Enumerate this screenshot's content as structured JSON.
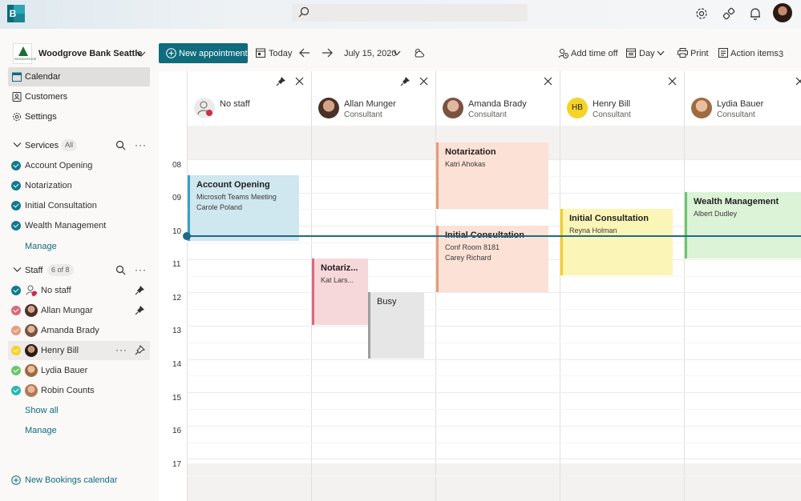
{
  "app": {
    "logo_letter": "B",
    "brand_color": "#0f6c7d"
  },
  "search": {
    "placeholder": ""
  },
  "org": {
    "name": "Woodgrove Bank Seattle",
    "logo_text": "WOODGROVE"
  },
  "nav": {
    "calendar": "Calendar",
    "customers": "Customers",
    "settings": "Settings"
  },
  "services": {
    "title": "Services",
    "filter": "All",
    "items": [
      "Account Opening",
      "Notarization",
      "Initial Consultation",
      "Wealth Management"
    ],
    "manage": "Manage"
  },
  "staff": {
    "title": "Staff",
    "count": "6 of 8",
    "items": [
      {
        "name": "No staff",
        "color": "#0f7a8c"
      },
      {
        "name": "Allan Mungar",
        "color": "#d86a7a"
      },
      {
        "name": "Amanda Brady",
        "color": "#e89a7a"
      },
      {
        "name": "Henry Bill",
        "color": "#f5d327"
      },
      {
        "name": "Lydia Bauer",
        "color": "#6cc66c"
      },
      {
        "name": "Robin Counts",
        "color": "#2ab7b3"
      }
    ],
    "show_all": "Show all",
    "manage": "Manage"
  },
  "new_calendar": "New Bookings calendar",
  "toolbar": {
    "new_appointment": "New appointment",
    "today": "Today",
    "date": "July 15, 2020",
    "add_time_off": "Add time off",
    "view": "Day",
    "print": "Print",
    "action_items": "Action items",
    "action_count": "3"
  },
  "calendar": {
    "hours": [
      "08",
      "09",
      "10",
      "11",
      "12",
      "13",
      "14",
      "15",
      "16",
      "17"
    ],
    "columns": [
      {
        "name": "No staff",
        "role": ""
      },
      {
        "name": "Allan Munger",
        "role": "Consultant"
      },
      {
        "name": "Amanda Brady",
        "role": "Consultant"
      },
      {
        "name": "Henry Bill",
        "role": "Consultant",
        "initials": "HB"
      },
      {
        "name": "Lydia Bauer",
        "role": "Consultant"
      }
    ],
    "events": {
      "e1": {
        "title": "Account Opening",
        "line1": "Microsoft Teams Meeting",
        "line2": "Carole Poland"
      },
      "e2": {
        "title": "Notariz...",
        "line1": "Kat Lars..."
      },
      "e3": {
        "title": "Busy"
      },
      "e4": {
        "title": "Notarization",
        "line1": "Katri Ahokas"
      },
      "e5": {
        "title": "Initial Consultation",
        "line1": "Conf Room 8181",
        "line2": "Carey Richard"
      },
      "e6": {
        "title": "Initial Consultation",
        "line1": "Reyna Holman"
      },
      "e7": {
        "title": "Wealth Management",
        "line1": "Albert Dudley"
      }
    }
  }
}
